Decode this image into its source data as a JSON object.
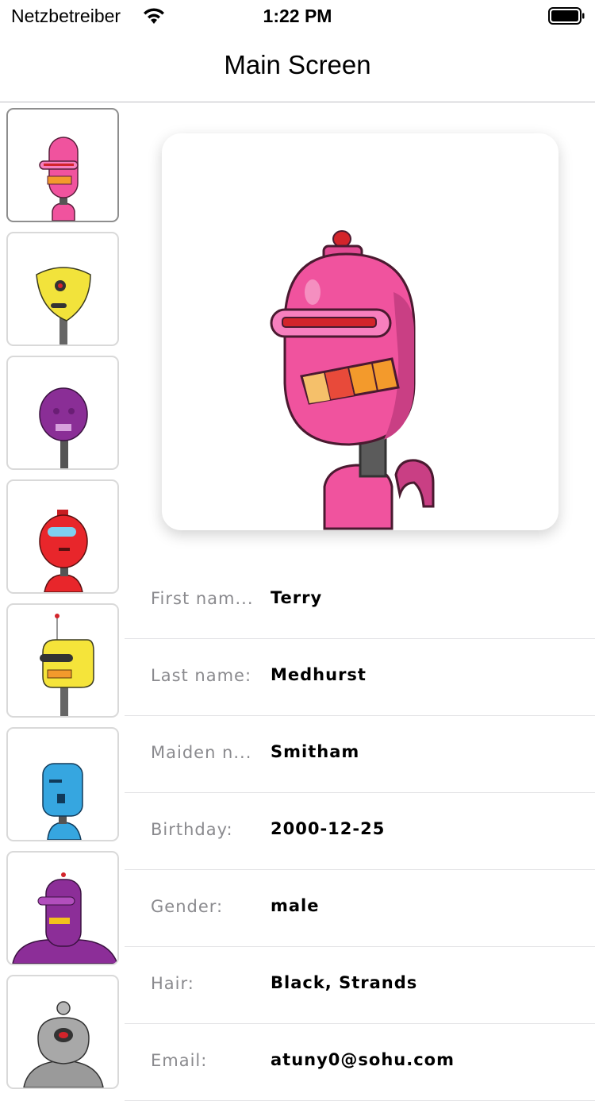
{
  "status_bar": {
    "carrier": "Netzbetreiber",
    "time": "1:22 PM",
    "icons": [
      "wifi-icon",
      "battery-icon"
    ]
  },
  "nav": {
    "title": "Main Screen"
  },
  "thumbnails": [
    {
      "name": "pink",
      "color": "#f0539e",
      "selected": true
    },
    {
      "name": "yellow",
      "color": "#f2e33b",
      "selected": false
    },
    {
      "name": "purple",
      "color": "#8a2e96",
      "selected": false
    },
    {
      "name": "red",
      "color": "#e8262b",
      "selected": false
    },
    {
      "name": "yellow-antenna",
      "color": "#f5e43a",
      "selected": false
    },
    {
      "name": "blue",
      "color": "#36a6e0",
      "selected": false
    },
    {
      "name": "purple-wide",
      "color": "#8c2e98",
      "selected": false
    },
    {
      "name": "gray",
      "color": "#9a9a9a",
      "selected": false
    }
  ],
  "details": [
    {
      "label": "First nam...",
      "value": "Terry"
    },
    {
      "label": "Last name:",
      "value": "Medhurst"
    },
    {
      "label": "Maiden n...",
      "value": "Smitham"
    },
    {
      "label": "Birthday:",
      "value": "2000-12-25"
    },
    {
      "label": "Gender:",
      "value": "male"
    },
    {
      "label": "Hair:",
      "value": "Black, Strands"
    },
    {
      "label": "Email:",
      "value": "atuny0@sohu.com"
    }
  ],
  "colors": {
    "separator": "#e3e3e6",
    "label": "#8a8a8e",
    "card_shadow": "rgba(0,0,0,0.18)"
  }
}
